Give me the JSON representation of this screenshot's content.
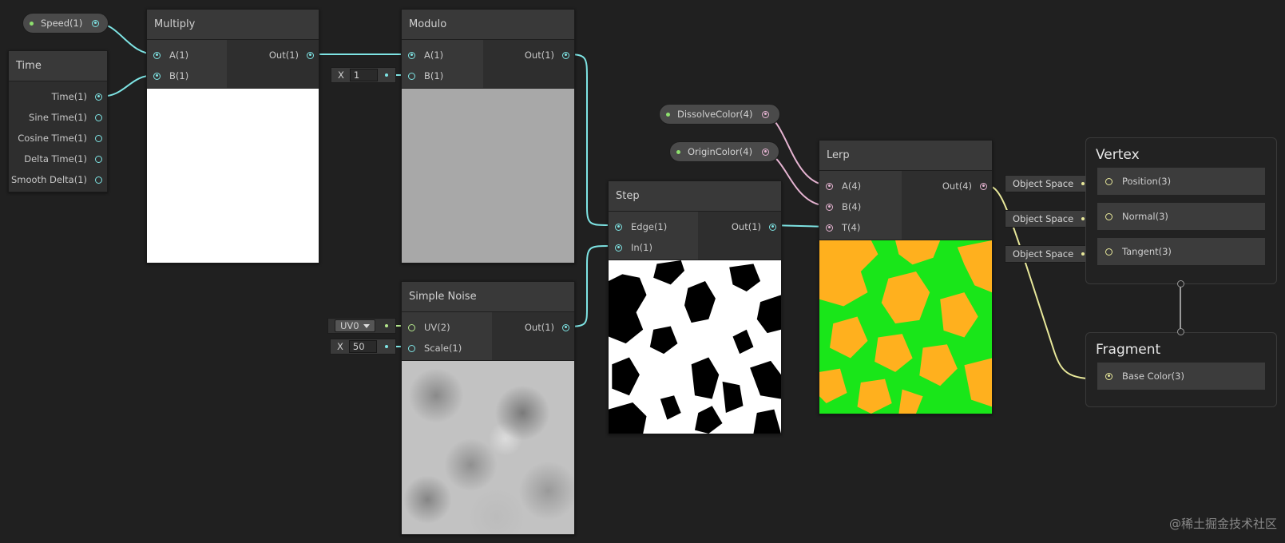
{
  "colors": {
    "background": "#202020",
    "wire_float": "#7ee4e4",
    "wire_vector4": "#e6b4d2",
    "wire_vector3": "#e8e89a",
    "wire_vector2": "#b4e68c",
    "lerp_color_a": "#ffb01e",
    "lerp_color_b": "#19e619"
  },
  "properties": {
    "speed": "Speed(1)",
    "dissolve_color": "DissolveColor(4)",
    "origin_color": "OriginColor(4)"
  },
  "time_node": {
    "title": "Time",
    "outputs": [
      "Time(1)",
      "Sine Time(1)",
      "Cosine Time(1)",
      "Delta Time(1)",
      "Smooth Delta(1)"
    ]
  },
  "multiply_node": {
    "title": "Multiply",
    "inputs": [
      "A(1)",
      "B(1)"
    ],
    "output": "Out(1)",
    "preview_value": "white"
  },
  "modulo_node": {
    "title": "Modulo",
    "inputs": [
      "A(1)",
      "B(1)"
    ],
    "output": "Out(1)",
    "b_label": "X",
    "b_value": "1",
    "preview_value": "gray"
  },
  "simple_noise_node": {
    "title": "Simple Noise",
    "inputs": [
      "UV(2)",
      "Scale(1)"
    ],
    "output": "Out(1)",
    "uv_option": "UV0",
    "scale_label": "X",
    "scale_value": "50"
  },
  "step_node": {
    "title": "Step",
    "inputs": [
      "Edge(1)",
      "In(1)"
    ],
    "output": "Out(1)"
  },
  "lerp_node": {
    "title": "Lerp",
    "inputs": [
      "A(4)",
      "B(4)",
      "T(4)"
    ],
    "output": "Out(4)"
  },
  "vertex_block": {
    "title": "Vertex",
    "slots": [
      {
        "label": "Position(3)",
        "space": "Object Space"
      },
      {
        "label": "Normal(3)",
        "space": "Object Space"
      },
      {
        "label": "Tangent(3)",
        "space": "Object Space"
      }
    ]
  },
  "fragment_block": {
    "title": "Fragment",
    "slots": [
      {
        "label": "Base Color(3)"
      }
    ]
  },
  "watermark": "@稀土掘金技术社区"
}
